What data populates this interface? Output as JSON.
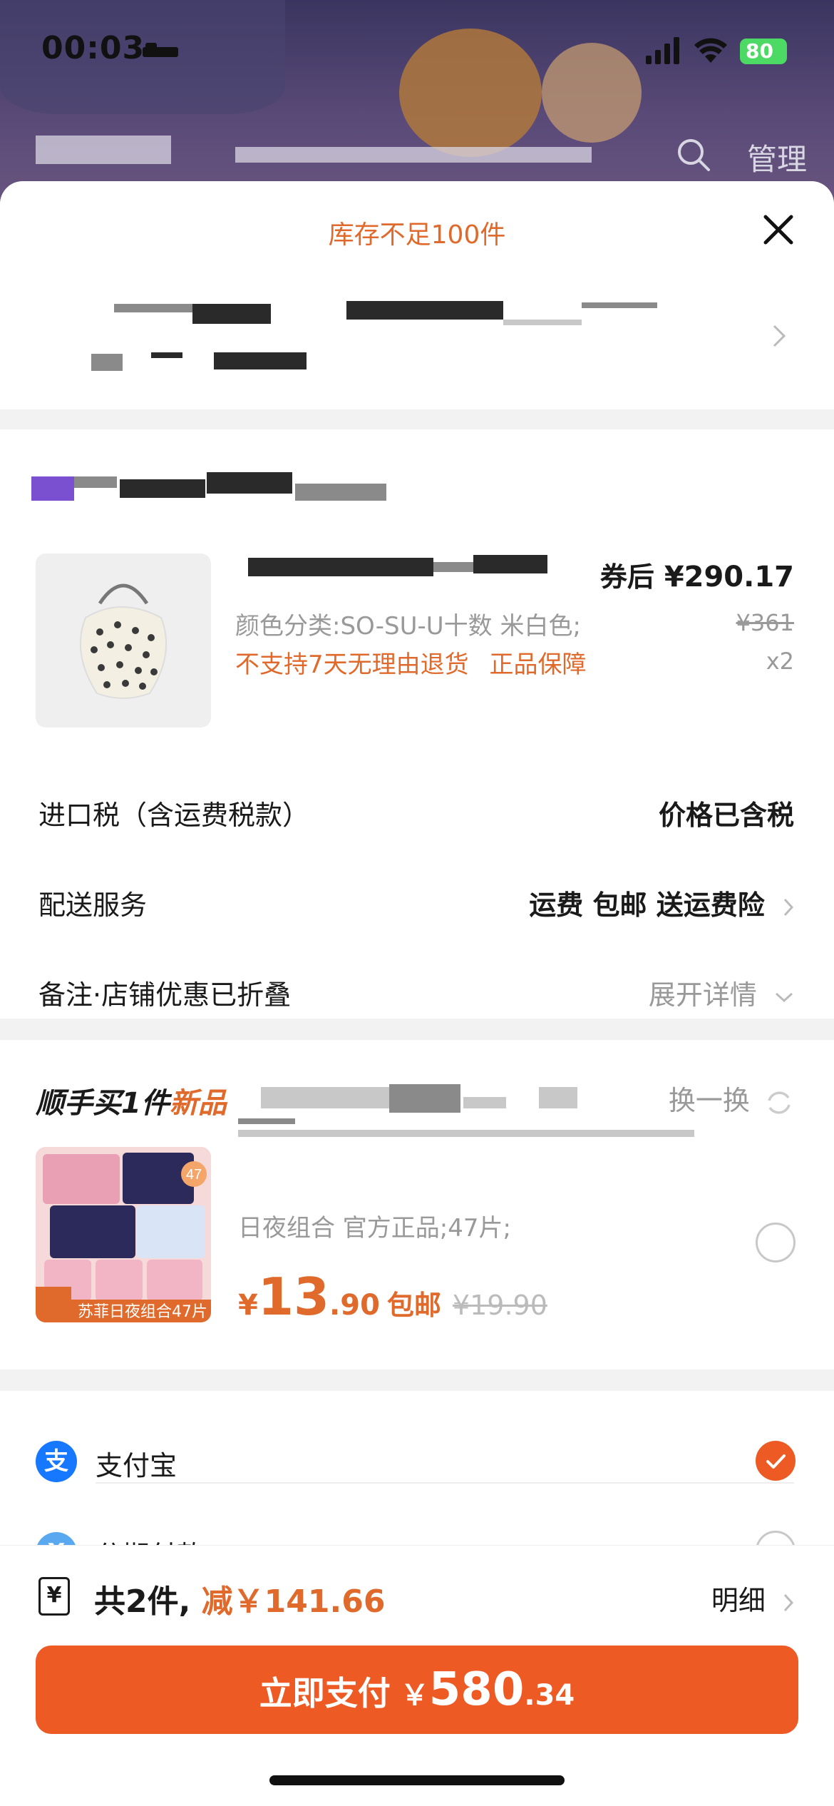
{
  "status_bar": {
    "time": "00:03",
    "battery": "80"
  },
  "nav": {
    "manage_label": "管理"
  },
  "stock_notice": "库存不足100件",
  "product": {
    "price_after_coupon_label": "券后",
    "price_after_coupon": "¥290.17",
    "variant": "颜色分类:SO-SU-U十数 米白色;",
    "original_price": "¥361",
    "warning": "不支持7天无理由退货",
    "guarantee": "正品保障",
    "quantity": "x2"
  },
  "rows": {
    "tax_label": "进口税（含运费税款）",
    "tax_value": "价格已含税",
    "delivery_label": "配送服务",
    "delivery_value": "运费 包邮 送运费险",
    "note_label": "备注·店铺优惠已折叠",
    "note_value": "展开详情"
  },
  "upsell": {
    "title_prefix": "顺手买1件",
    "title_new": "新品",
    "swap_label": "换一换",
    "image_caption": "苏菲日夜组合47片",
    "image_badge": "47",
    "subtitle": "日夜组合 官方正品;47片;",
    "price_currency": "¥",
    "price_int": "13",
    "price_dec": ".90",
    "shipping": "包邮",
    "old_price": "¥19.90"
  },
  "payment": {
    "options": [
      {
        "label": "支付宝",
        "icon": "alipay-icon",
        "selected": true
      },
      {
        "label": "分期付款",
        "icon": "installment-icon",
        "selected": false
      }
    ]
  },
  "footer": {
    "count_label": "共2件,",
    "discount_label": "减￥141.66",
    "detail_label": "明细",
    "pay_label": "立即支付",
    "pay_currency": "￥",
    "pay_int": "580",
    "pay_dec": ".34"
  },
  "colors": {
    "accent": "#ee5a24",
    "orange_text": "#e06a2c",
    "alipay_blue": "#1677ff"
  }
}
